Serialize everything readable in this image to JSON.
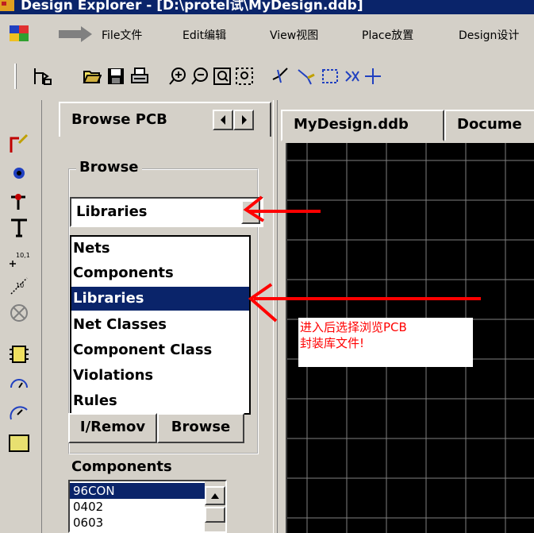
{
  "window": {
    "title": "Design Explorer - [D:\\protel试\\MyDesign.ddb]"
  },
  "menu": {
    "items": [
      "File文件",
      "Edit编辑",
      "View视图",
      "Place放置",
      "Design设计"
    ]
  },
  "toolbar": {
    "icons": [
      "layers-icon",
      "open-folder-icon",
      "save-icon",
      "print-icon",
      "zoom-in-icon",
      "zoom-out-icon",
      "zoom-fit-icon",
      "zoom-area-icon",
      "interactive-route-icon",
      "wire-icon",
      "select-rect-icon",
      "deselect-icon",
      "move-cross-icon"
    ]
  },
  "left_tools": {
    "icons": [
      "arc-pen-icon",
      "pad-icon",
      "via-icon",
      "text-icon",
      "coordinate-icon",
      "dimension-icon",
      "origin-icon",
      "component-icon",
      "arc-center-icon",
      "arc-edge-icon",
      "fill-icon"
    ]
  },
  "panel": {
    "tab_label": "Browse PCB",
    "browse_group_label": "Browse",
    "browse_value": "Libraries",
    "dropdown_options": [
      "Nets",
      "Components",
      "Libraries",
      "Net Classes",
      "Component Class",
      "Violations",
      "Rules"
    ],
    "dropdown_selected_index": 2,
    "buttons": [
      "I/Remov",
      "Browse"
    ],
    "components_label": "Components",
    "components_list": [
      "96CON",
      "0402",
      "0603"
    ],
    "components_selected_index": 0
  },
  "document": {
    "tabs": [
      "MyDesign.ddb",
      "Docume"
    ]
  },
  "annotation": {
    "text": "进入后选择浏览PCB\n封装库文件!",
    "color": "#ff0000"
  },
  "colors": {
    "titlebar": "#0a246a",
    "selection": "#0a246a",
    "canvas_bg": "#000000",
    "grid": "#808080",
    "arrow": "#ff0000"
  }
}
